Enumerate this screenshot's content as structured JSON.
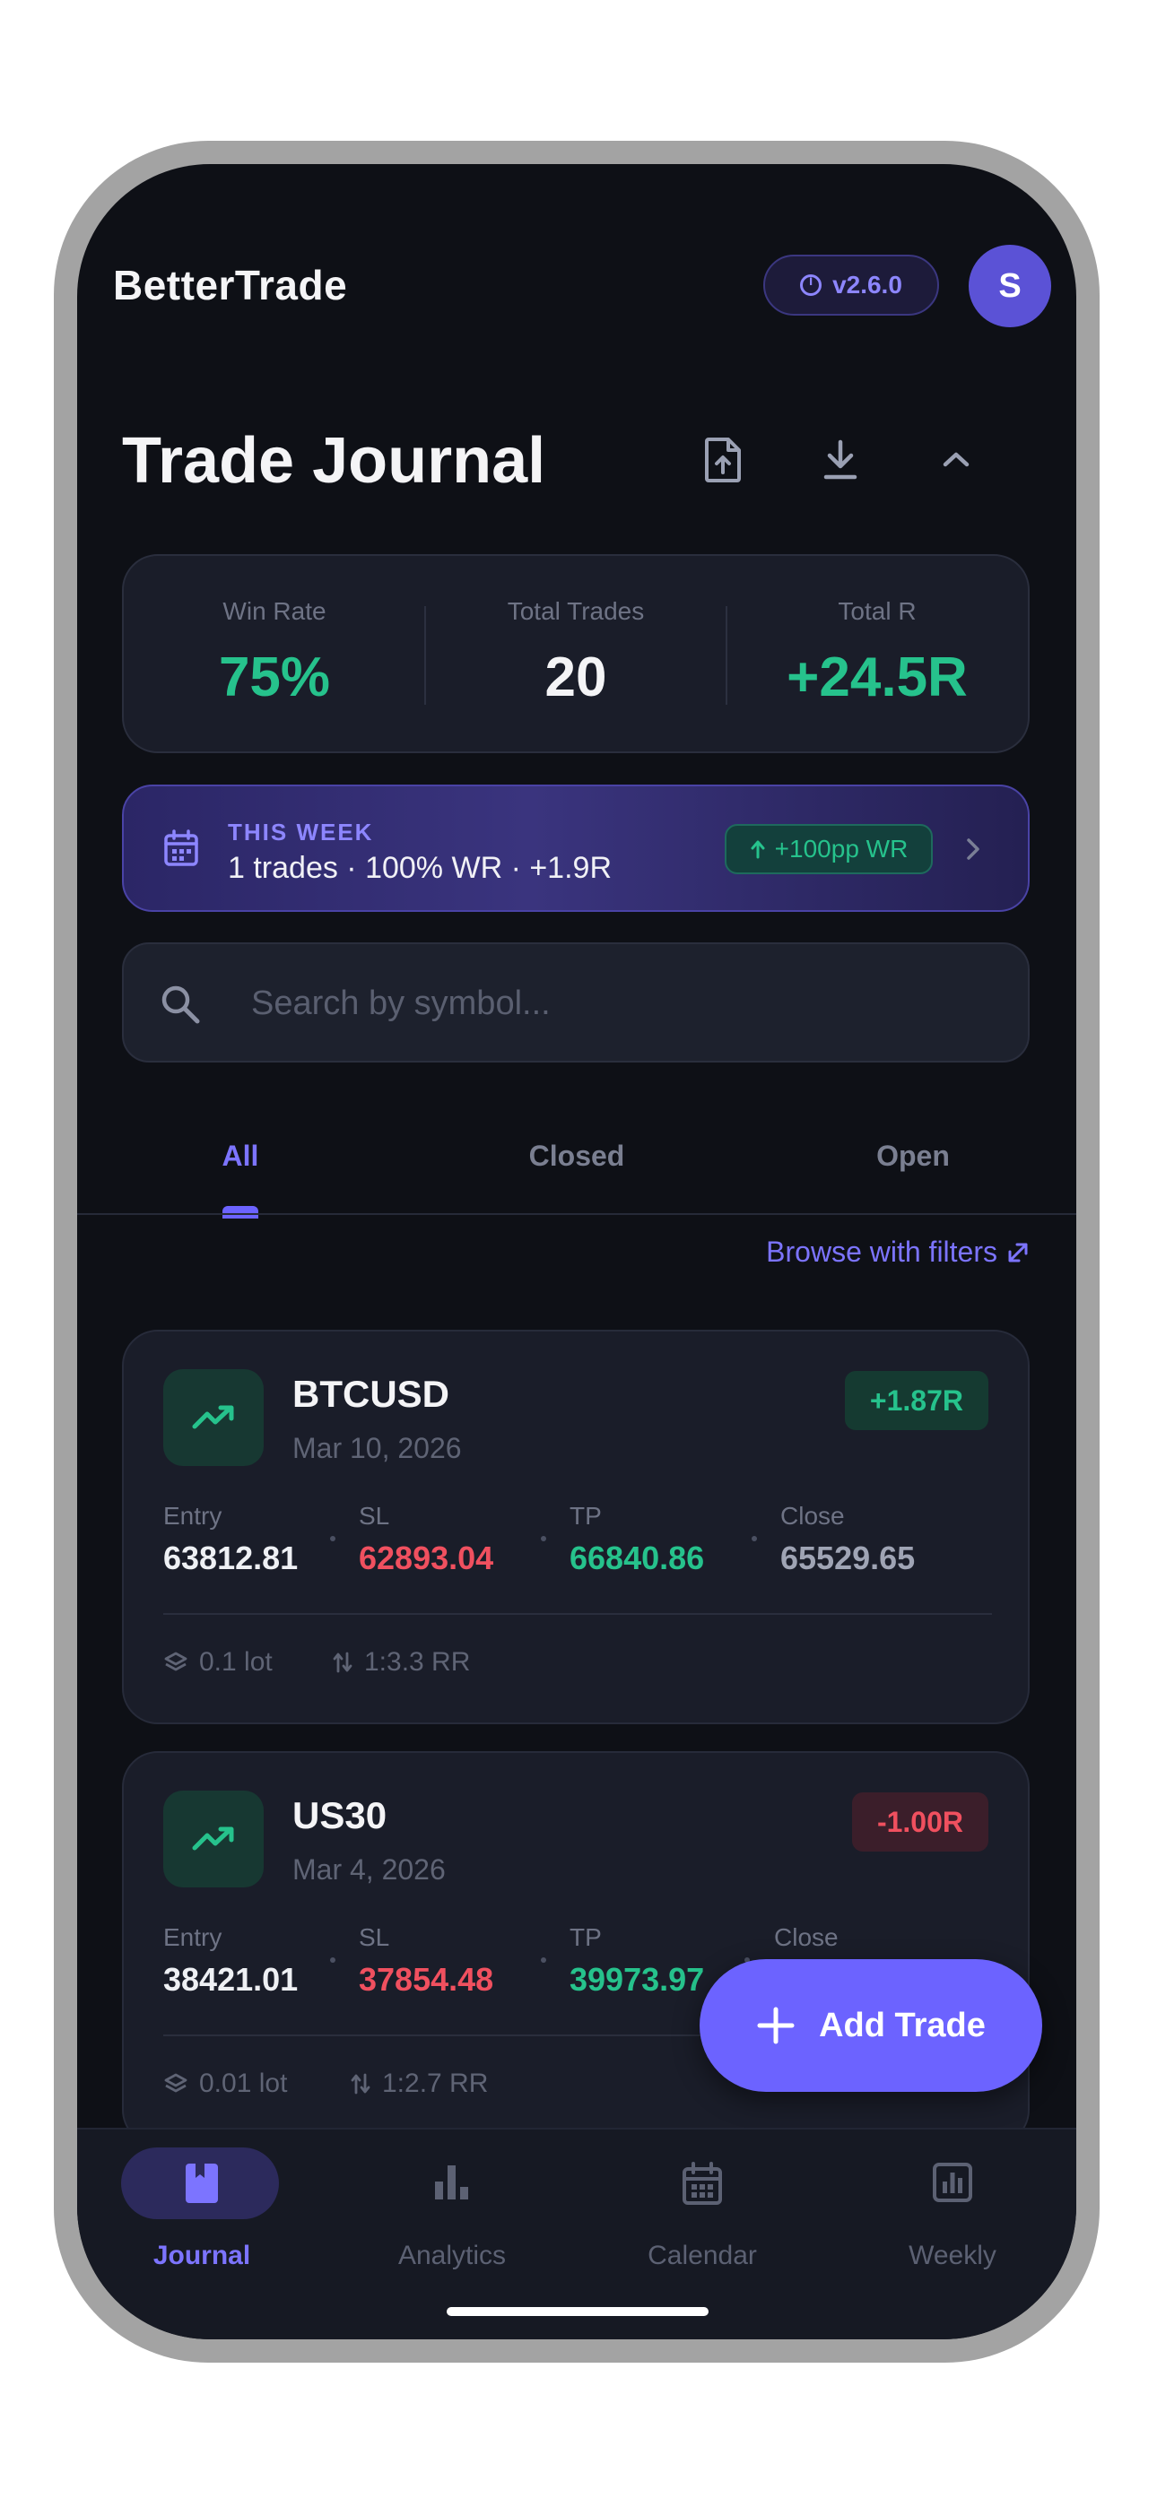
{
  "app": {
    "brand": "BetterTrade",
    "version": "v2.6.0",
    "avatar_initial": "S"
  },
  "page": {
    "title": "Trade Journal"
  },
  "toolbar": {
    "icons": [
      "file-upload-icon",
      "download-icon",
      "chevron-up-icon"
    ]
  },
  "stats": {
    "win_rate": {
      "label": "Win Rate",
      "value": "75%"
    },
    "total_trades": {
      "label": "Total Trades",
      "value": "20"
    },
    "total_r": {
      "label": "Total R",
      "value": "+24.5R"
    }
  },
  "week": {
    "eyebrow": "THIS WEEK",
    "summary": "1 trades · 100% WR · +1.9R",
    "badge": "+100pp WR"
  },
  "search": {
    "placeholder": "Search by symbol..."
  },
  "tabs": [
    {
      "label": "All",
      "active": true
    },
    {
      "label": "Closed",
      "active": false
    },
    {
      "label": "Open",
      "active": false
    }
  ],
  "browse_label": "Browse with filters",
  "field_labels": {
    "entry": "Entry",
    "sl": "SL",
    "tp": "TP",
    "close": "Close"
  },
  "trades": [
    {
      "symbol": "BTCUSD",
      "date": "Mar 10, 2026",
      "r": "+1.87R",
      "entry": "63812.81",
      "sl": "62893.04",
      "tp": "66840.86",
      "close": "65529.65",
      "lot": "0.1 lot",
      "rr": "1:3.3 RR"
    },
    {
      "symbol": "US30",
      "date": "Mar 4, 2026",
      "r": "-1.00R",
      "entry": "38421.01",
      "sl": "37854.48",
      "tp": "39973.97",
      "close": "",
      "lot": "0.01 lot",
      "rr": "1:2.7 RR"
    }
  ],
  "fab": {
    "label": "Add Trade"
  },
  "nav": [
    {
      "label": "Journal",
      "icon": "book-icon",
      "active": true
    },
    {
      "label": "Analytics",
      "icon": "bar-chart-icon",
      "active": false
    },
    {
      "label": "Calendar",
      "icon": "calendar-icon",
      "active": false
    },
    {
      "label": "Weekly",
      "icon": "report-chart-icon",
      "active": false
    }
  ],
  "colors": {
    "accent": "#6c63ff",
    "positive": "#26c28c",
    "negative": "#f0505f",
    "background": "#0e1016",
    "card": "#1a1d29"
  }
}
